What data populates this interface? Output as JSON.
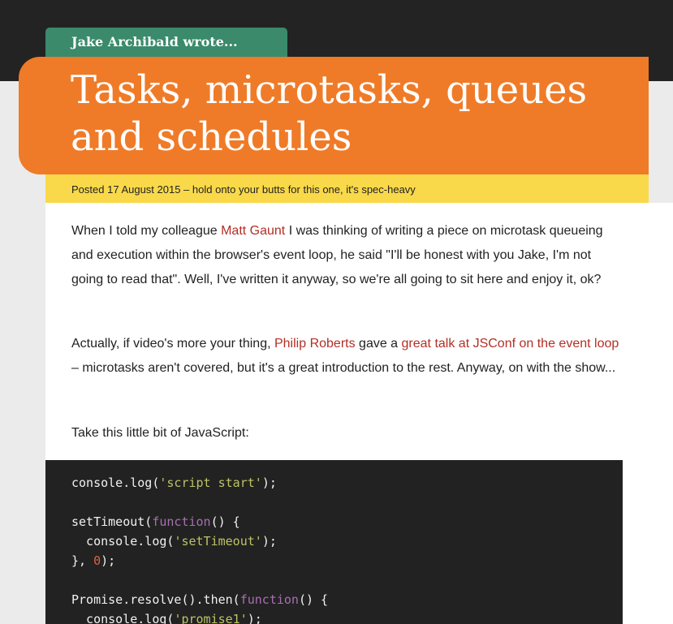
{
  "header": {
    "author_tab": "Jake Archibald wrote...",
    "title": "Tasks, microtasks, queues and schedules"
  },
  "meta": {
    "posted_text": "Posted 17 August 2015 – hold onto your butts for this one, it's spec-heavy"
  },
  "article": {
    "para1": {
      "t1": "When I told my colleague ",
      "link": "Matt Gaunt",
      "t2": " I was thinking of writing a piece on microtask queueing and execution within the browser's event loop, he said \"I'll be honest with you Jake, I'm not going to read that\". Well, I've written it anyway, so we're all going to sit here and enjoy it, ok?"
    },
    "para2": {
      "t1": "Actually, if video's more your thing, ",
      "link1": "Philip Roberts",
      "t2": " gave a ",
      "link2": "great talk at JSConf on the event loop",
      "t3": " – microtasks aren't covered, but it's a great introduction to the rest. Anyway, on with the show..."
    },
    "para3": "Take this little bit of JavaScript:"
  },
  "code": {
    "line1": {
      "a": "console.log(",
      "s": "'script start'",
      "b": ");"
    },
    "line3": {
      "a": "setTimeout(",
      "kw": "function",
      "b": "() {"
    },
    "line4": {
      "a": "  console.log(",
      "s": "'setTimeout'",
      "b": ");"
    },
    "line5": {
      "a": "}, ",
      "n": "0",
      "b": ");"
    },
    "line7": {
      "a": "Promise.resolve().then(",
      "kw": "function",
      "b": "() {"
    },
    "line8": {
      "a": "  console.log(",
      "s": "'promise1'",
      "b": ");"
    }
  },
  "colors": {
    "header_dark": "#232323",
    "author_tab_green": "#3a8a6b",
    "title_orange": "#ef7b28",
    "meta_yellow": "#f9d94a",
    "link_red": "#b22f26",
    "code_bg": "#222222",
    "code_string": "#bcc365",
    "code_keyword": "#a86fb4",
    "code_number": "#e2603d"
  }
}
